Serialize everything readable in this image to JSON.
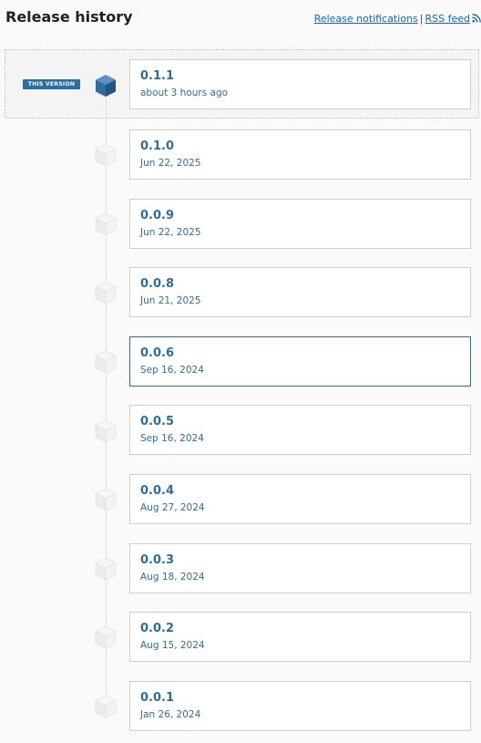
{
  "header": {
    "title": "Release history",
    "notifications_label": "Release notifications",
    "separator": "|",
    "rss_label": "RSS feed"
  },
  "current_badge": "THIS VERSION",
  "colors": {
    "accent": "#2b6ea4",
    "link": "#0d66c2",
    "card_border": "#cfcfcf",
    "background": "#fafafa"
  },
  "releases": [
    {
      "version": "0.1.1",
      "date": "about 3 hours ago",
      "current": true
    },
    {
      "version": "0.1.0",
      "date": "Jun 22, 2025"
    },
    {
      "version": "0.0.9",
      "date": "Jun 22, 2025"
    },
    {
      "version": "0.0.8",
      "date": "Jun 21, 2025"
    },
    {
      "version": "0.0.6",
      "date": "Sep 16, 2024",
      "highlighted": true
    },
    {
      "version": "0.0.5",
      "date": "Sep 16, 2024"
    },
    {
      "version": "0.0.4",
      "date": "Aug 27, 2024"
    },
    {
      "version": "0.0.3",
      "date": "Aug 18, 2024"
    },
    {
      "version": "0.0.2",
      "date": "Aug 15, 2024"
    },
    {
      "version": "0.0.1",
      "date": "Jan 26, 2024"
    }
  ]
}
